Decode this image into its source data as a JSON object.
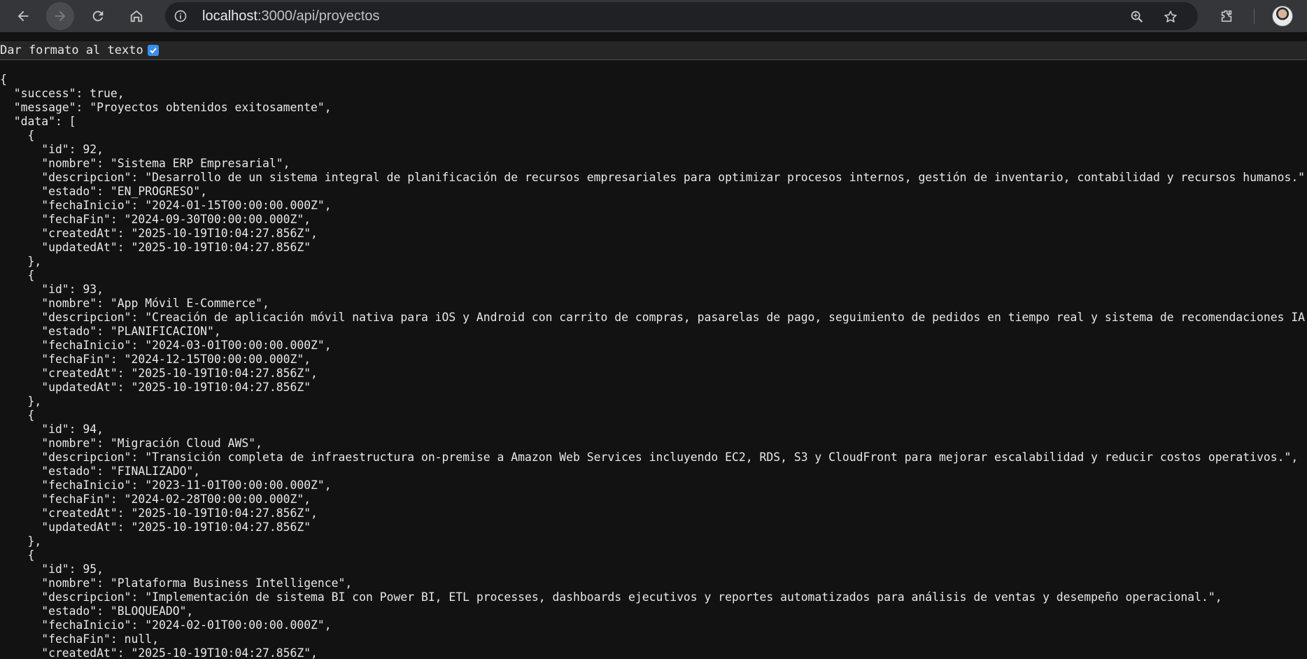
{
  "browser": {
    "url_host": "localhost",
    "url_path": ":3000/api/proyectos"
  },
  "pretty_print": {
    "label": "Dar formato al texto",
    "checked": true
  },
  "json_lines": [
    "{",
    "  \"success\": true,",
    "  \"message\": \"Proyectos obtenidos exitosamente\",",
    "  \"data\": [",
    "    {",
    "      \"id\": 92,",
    "      \"nombre\": \"Sistema ERP Empresarial\",",
    "      \"descripcion\": \"Desarrollo de un sistema integral de planificación de recursos empresariales para optimizar procesos internos, gestión de inventario, contabilidad y recursos humanos.\",",
    "      \"estado\": \"EN_PROGRESO\",",
    "      \"fechaInicio\": \"2024-01-15T00:00:00.000Z\",",
    "      \"fechaFin\": \"2024-09-30T00:00:00.000Z\",",
    "      \"createdAt\": \"2025-10-19T10:04:27.856Z\",",
    "      \"updatedAt\": \"2025-10-19T10:04:27.856Z\"",
    "    },",
    "    {",
    "      \"id\": 93,",
    "      \"nombre\": \"App Móvil E-Commerce\",",
    "      \"descripcion\": \"Creación de aplicación móvil nativa para iOS y Android con carrito de compras, pasarelas de pago, seguimiento de pedidos en tiempo real y sistema de recomendaciones IA.\",",
    "      \"estado\": \"PLANIFICACION\",",
    "      \"fechaInicio\": \"2024-03-01T00:00:00.000Z\",",
    "      \"fechaFin\": \"2024-12-15T00:00:00.000Z\",",
    "      \"createdAt\": \"2025-10-19T10:04:27.856Z\",",
    "      \"updatedAt\": \"2025-10-19T10:04:27.856Z\"",
    "    },",
    "    {",
    "      \"id\": 94,",
    "      \"nombre\": \"Migración Cloud AWS\",",
    "      \"descripcion\": \"Transición completa de infraestructura on-premise a Amazon Web Services incluyendo EC2, RDS, S3 y CloudFront para mejorar escalabilidad y reducir costos operativos.\",",
    "      \"estado\": \"FINALIZADO\",",
    "      \"fechaInicio\": \"2023-11-01T00:00:00.000Z\",",
    "      \"fechaFin\": \"2024-02-28T00:00:00.000Z\",",
    "      \"createdAt\": \"2025-10-19T10:04:27.856Z\",",
    "      \"updatedAt\": \"2025-10-19T10:04:27.856Z\"",
    "    },",
    "    {",
    "      \"id\": 95,",
    "      \"nombre\": \"Plataforma Business Intelligence\",",
    "      \"descripcion\": \"Implementación de sistema BI con Power BI, ETL processes, dashboards ejecutivos y reportes automatizados para análisis de ventas y desempeño operacional.\",",
    "      \"estado\": \"BLOQUEADO\",",
    "      \"fechaInicio\": \"2024-02-01T00:00:00.000Z\",",
    "      \"fechaFin\": null,",
    "      \"createdAt\": \"2025-10-19T10:04:27.856Z\","
  ],
  "icons": {
    "back": "back-arrow-icon",
    "forward": "forward-arrow-icon",
    "reload": "reload-icon",
    "home": "home-icon",
    "site_info": "site-info-icon",
    "zoom": "zoom-icon",
    "bookmark": "star-icon",
    "extensions": "puzzle-icon",
    "profile": "avatar"
  },
  "colors": {
    "toolbar_bg": "#35363a",
    "omnibox_bg": "#202124",
    "page_bg": "#121212",
    "checkbox_accent": "#3b8eea"
  }
}
